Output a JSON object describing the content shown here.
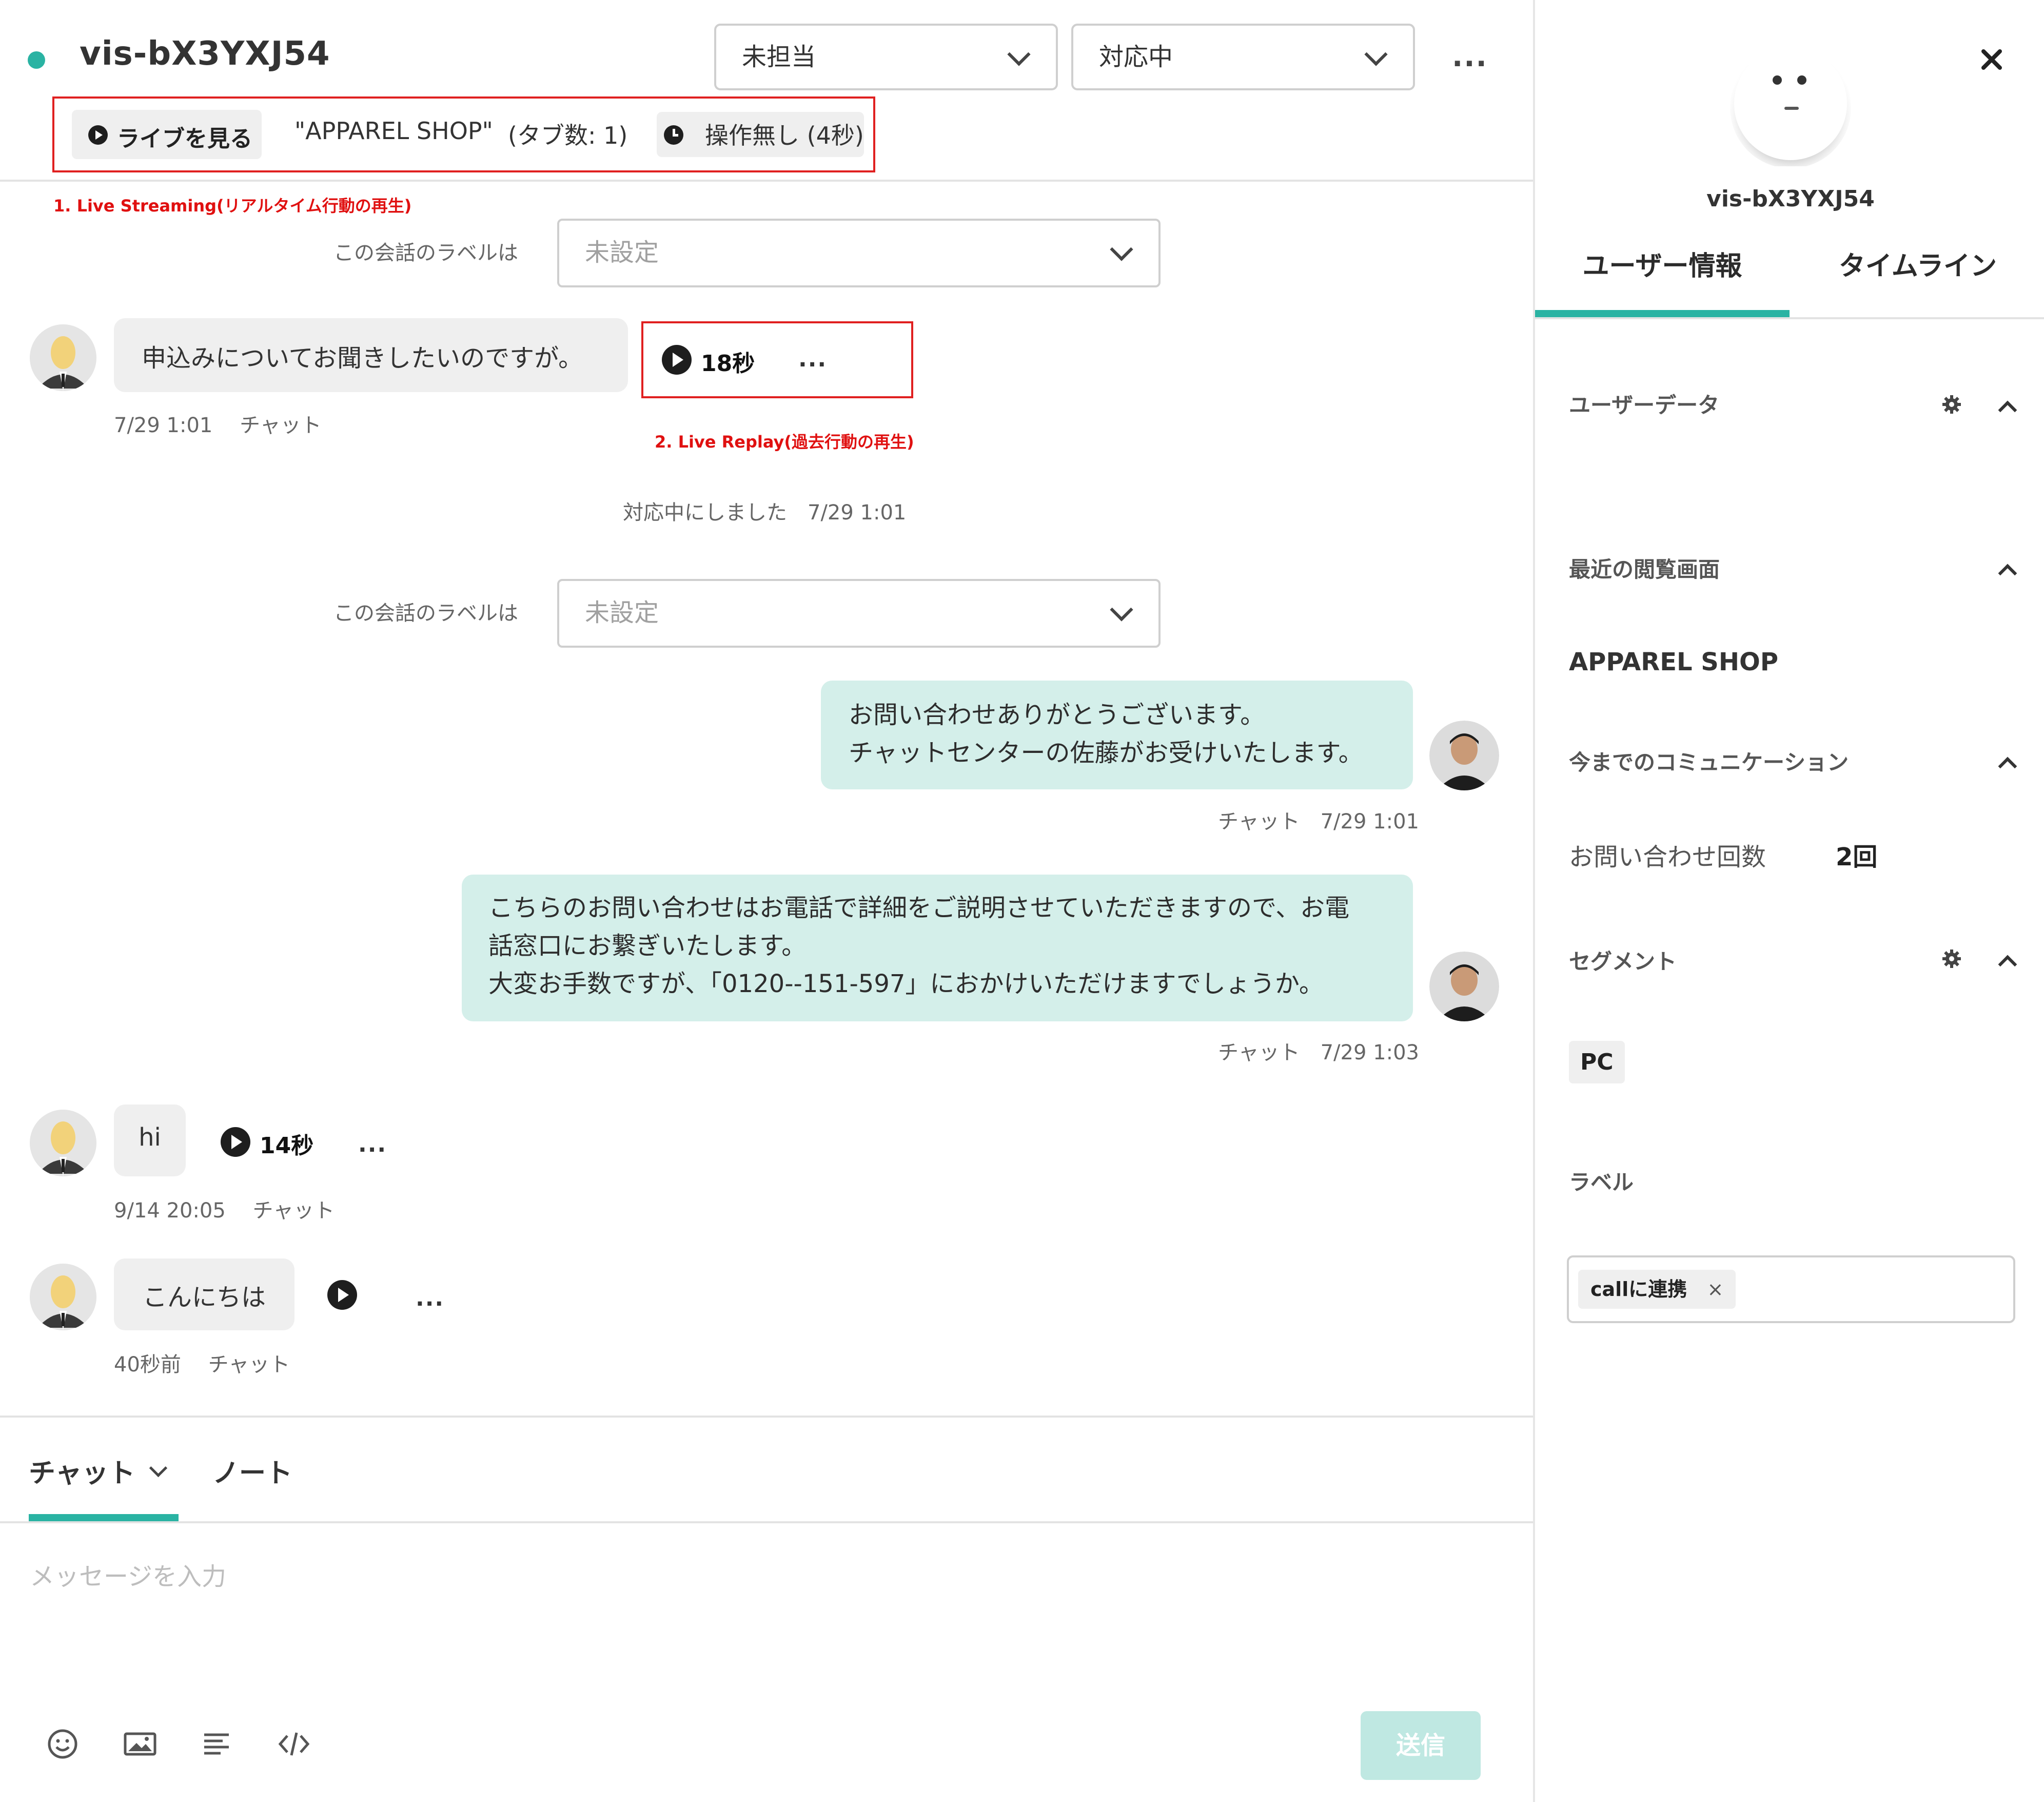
{
  "header": {
    "visitor_id": "vis-bX3YXJ54",
    "assignee_select": "未担当",
    "status_select": "対応中",
    "more": "...",
    "live_button": "ライブを見る",
    "page_title": "\"APPAREL SHOP\"",
    "tab_count": "(タブ数: 1)",
    "idle_status": "操作無し (4秒)",
    "note_live_streaming": "1. Live Streaming(リアルタイム行動の再生)"
  },
  "conversation": {
    "label_question": "この会話のラベルは",
    "label_placeholder": "未設定",
    "messages": [
      {
        "text": "申込みについてお聞きしたいのですが。",
        "meta": "7/29 1:01 　チャット",
        "replay": "18秒",
        "more": "..."
      },
      {
        "text": "お問い合わせありがとうございます。",
        "text2": "チャットセンターの佐藤がお受けいたします。",
        "meta": "チャット　7/29 1:01"
      },
      {
        "text": "こちらのお問い合わせはお電話で詳細をご説明させていただきますので、お電",
        "text2": "話窓口にお繋ぎいたします。",
        "text3": "大変お手数ですが、「0120--151-597」におかけいただけますでしょうか。",
        "meta": "チャット　7/29 1:03"
      },
      {
        "text": "hi",
        "meta": "9/14 20:05 　チャット",
        "replay": "14秒",
        "more": "..."
      },
      {
        "text": "こんにちは",
        "meta": "40秒前 　チャット",
        "more": "..."
      }
    ],
    "note_live_replay": "2. Live Replay(過去行動の再生)",
    "system_event": "対応中にしました　7/29 1:01"
  },
  "composer": {
    "tab_chat": "チャット",
    "tab_note": "ノート",
    "placeholder": "メッセージを入力",
    "send": "送信",
    "icons": [
      "emoji-icon",
      "image-icon",
      "template-icon",
      "code-icon"
    ]
  },
  "sidebar": {
    "visitor_id": "vis-bX3YXJ54",
    "tab_user_info": "ユーザー情報",
    "tab_timeline": "タイムライン",
    "section_user_data": "ユーザーデータ",
    "section_recent_pages": "最近の閲覧画面",
    "recent_page": "APPAREL SHOP",
    "section_communication": "今までのコミュニケーション",
    "inquiry_count_label": "お問い合わせ回数",
    "inquiry_count_value": "2回",
    "section_segment": "セグメント",
    "segment_value": "PC",
    "section_label": "ラベル",
    "label_tag": "callに連携",
    "label_tag_remove": "×"
  },
  "colors": {
    "accent": "#2ab3a3",
    "outgoing_bubble": "#d4efea",
    "incoming_bubble": "#efefef",
    "annotation_red": "#e02020",
    "send_disabled": "#bfe8e2"
  }
}
